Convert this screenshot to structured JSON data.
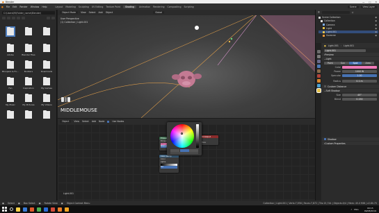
{
  "window": {
    "title": "Blender",
    "controls": [
      "—",
      "□",
      "✕"
    ]
  },
  "menubar": {
    "menus": [
      "File",
      "Edit",
      "Render",
      "Window",
      "Help"
    ],
    "workspaces": [
      "Layout",
      "Modeling",
      "Sculpting",
      "UV Editing",
      "Texture Paint",
      "Shading",
      "Animation",
      "Rendering",
      "Compositing",
      "Scripting"
    ],
    "active_workspace": "Shading",
    "scene": "Scene",
    "view_layer": "View Layer"
  },
  "file_browser": {
    "path": "C:\\Users\\Mi\\Folder_name\\Blender\\",
    "items": [
      {
        "name": "..",
        "selected": true
      },
      {
        "name": ""
      },
      {
        "name": ""
      },
      {
        "name": ""
      },
      {
        "name": "Adobe"
      },
      {
        "name": "Blender Files"
      },
      {
        "name": ""
      },
      {
        "name": ""
      },
      {
        "name": ""
      },
      {
        "name": "Bloopers & Fx..."
      },
      {
        "name": "Builders"
      },
      {
        "name": "Downloads"
      },
      {
        "name": ""
      },
      {
        "name": ""
      },
      {
        "name": ""
      },
      {
        "name": "Fan"
      },
      {
        "name": "Inspiration"
      },
      {
        "name": "My Games"
      },
      {
        "name": ""
      },
      {
        "name": ""
      },
      {
        "name": ""
      },
      {
        "name": "My Music"
      },
      {
        "name": "My Pictures"
      },
      {
        "name": "My Videos"
      },
      {
        "name": ""
      },
      {
        "name": ""
      },
      {
        "name": ""
      }
    ]
  },
  "viewport": {
    "header": [
      "Object Mode",
      "View",
      "Select",
      "Add",
      "Object",
      "Global"
    ],
    "info_line1": "User Perspective",
    "info_line2": "(1) Collection | Light.001",
    "key_overlay": "MIDDLEMOUSE"
  },
  "outliner": {
    "title": "Scene Collection",
    "rows": [
      {
        "label": "Scene Collection",
        "color": "#cfcfcf",
        "selected": false
      },
      {
        "label": "Collection",
        "color": "#e0e0e0",
        "selected": false
      },
      {
        "label": "Camera",
        "color": "#7fb0e8",
        "selected": false
      },
      {
        "label": "Light",
        "color": "#e6c34a",
        "selected": false
      },
      {
        "label": "Light.001",
        "color": "#e6c34a",
        "selected": true
      },
      {
        "label": "Suzanne",
        "color": "#f29a38",
        "selected": false
      }
    ]
  },
  "properties": {
    "header_left": "Light.001",
    "header_right": "Light.001",
    "data_name": "Light.001",
    "sections": {
      "preview": "Preview",
      "light": "Light",
      "custom_distance": "Custom Distance",
      "soft_shadow": "Soft Shadow",
      "shadow": "Shadow",
      "custom_properties": "Custom Properties"
    },
    "light_types": [
      "Point",
      "Sun",
      "Spot",
      "Area"
    ],
    "active_light_type": "Spot",
    "fields": [
      {
        "label": "Color",
        "value": ""
      },
      {
        "label": "Power",
        "value": "1000 W"
      },
      {
        "label": "Specular",
        "value": "1.00"
      },
      {
        "label": "Radius",
        "value": "0.1 m"
      }
    ],
    "spot_fields": [
      {
        "label": "Size",
        "value": "45°"
      },
      {
        "label": "Blend",
        "value": "0.150"
      }
    ]
  },
  "node_editor": {
    "header": [
      "Object",
      "View",
      "Select",
      "Add",
      "Node",
      "Use Nodes"
    ],
    "frame_label": "Light.001",
    "nodes": [
      {
        "title": "Emission",
        "header_color": "#3a6b4c",
        "lines": [
          "Emission",
          "Color",
          "Strength"
        ]
      },
      {
        "title": "Light Output",
        "header_color": "#8a2b2b",
        "lines": [
          "All",
          "Surface"
        ]
      },
      {
        "title": "Color Ramp",
        "header_color": "#3b5f7d",
        "lines": [
          "Color",
          "Alpha",
          "Fac"
        ]
      }
    ]
  },
  "picker": {
    "modes": [
      "RGB",
      "HSV",
      "HSL"
    ],
    "active_mode": "HSV"
  },
  "statusbar": {
    "left": [
      "Select",
      "Box Select",
      "Rotate View",
      "Object Context Menu"
    ],
    "stats": "Collection | Light.001 | Verts:7,958 | Faces:7,872 | Tris:15,744 | Objects:0/4 | Mem: 45.0 MiB | v2.80.75"
  },
  "taskbar": {
    "time": "09:15",
    "date": "09/08/2019",
    "lang": "ENG",
    "app_colors": [
      "#f5d04a",
      "#3a7bd5",
      "#e05a2b",
      "#4caf50",
      "#2b6cd6",
      "#d44b3a",
      "#e87d2a",
      "#f5a623"
    ]
  }
}
